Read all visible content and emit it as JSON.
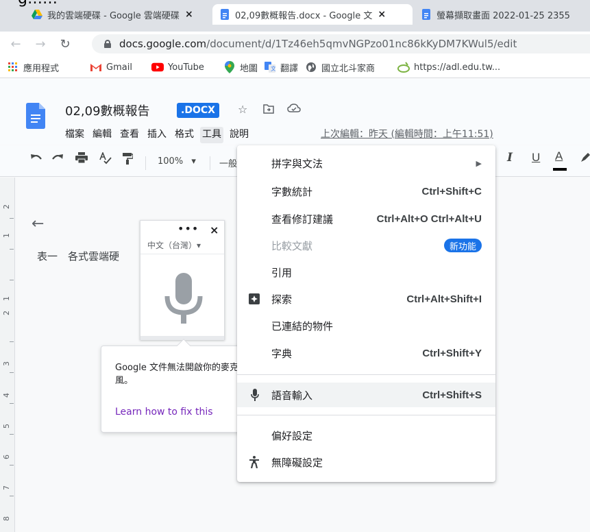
{
  "browser": {
    "tabs": [
      {
        "title": "我的雲端硬碟 - Google 雲端硬碟",
        "close": "×"
      },
      {
        "title": "02,09數概報告.docx - Google 文",
        "close": "×"
      },
      {
        "title": "螢幕擷取畫面 2022-01-25 2355"
      }
    ],
    "url_host": "docs.google.com",
    "url_path": "/document/d/1Tz46eh5qmvNGPzo01nc86kKyDM7KWul5/edit",
    "bookmarks": [
      "應用程式",
      "Gmail",
      "YouTube",
      "地圖",
      "翻譯",
      "國立北斗家商",
      "https://adl.edu.tw..."
    ]
  },
  "doc": {
    "title": "02,09數概報告",
    "badge": ".DOCX",
    "menus": [
      "檔案",
      "編輯",
      "查看",
      "插入",
      "格式",
      "工具",
      "說明"
    ],
    "last_edit": "上次編輯：昨天 (編輯時間：上午11:51)",
    "zoom": "100%",
    "style_partial": "一般",
    "body_text": "表一　各式雲端硬",
    "ruler_numbers": [
      "2",
      "1",
      "1",
      "2",
      "3",
      "4",
      "5",
      "6",
      "7",
      "8"
    ]
  },
  "voice_widget": {
    "more": "•••",
    "close": "×",
    "language": "中文（台灣）▾"
  },
  "tooltip": {
    "message": "Google 文件無法開啟你的麥克風。",
    "link": "Learn how to fix this"
  },
  "tools_menu": {
    "items": [
      {
        "label": "拼字與文法",
        "arrow": "▶"
      },
      {
        "label": "字數統計",
        "shortcut": "Ctrl+Shift+C"
      },
      {
        "label": "查看修訂建議",
        "shortcut": "Ctrl+Alt+O Ctrl+Alt+U"
      },
      {
        "label": "比較文獻",
        "badge": "新功能"
      },
      {
        "label": "引用"
      },
      {
        "label": "探索",
        "shortcut": "Ctrl+Alt+Shift+I"
      },
      {
        "label": "已連結的物件"
      },
      {
        "label": "字典",
        "shortcut": "Ctrl+Shift+Y"
      },
      {
        "label": "語音輸入",
        "shortcut": "Ctrl+Shift+S"
      },
      {
        "label": "偏好設定"
      },
      {
        "label": "無障礙設定"
      }
    ]
  },
  "colors": {
    "accent": "#1a73e8",
    "link_visited": "#7627bb",
    "hover": "#f1f3f4"
  }
}
